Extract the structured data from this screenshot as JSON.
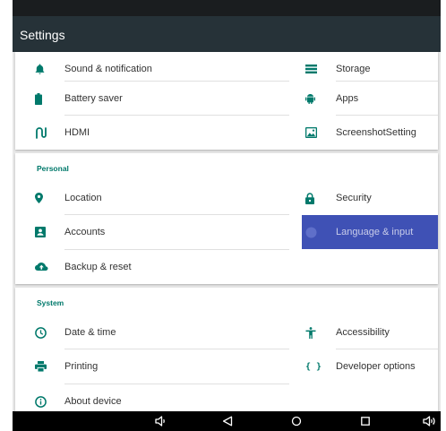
{
  "header": {
    "title": "Settings"
  },
  "device": {
    "items": [
      {
        "label": "Sound & notification",
        "icon": "bell-icon"
      },
      {
        "label": "Storage",
        "icon": "storage-icon"
      },
      {
        "label": "Battery saver",
        "icon": "battery-icon"
      },
      {
        "label": "Apps",
        "icon": "android-icon"
      },
      {
        "label": "HDMI",
        "icon": "hdmi-icon"
      },
      {
        "label": "ScreenshotSetting",
        "icon": "image-icon"
      }
    ]
  },
  "personal": {
    "title": "Personal",
    "items": [
      {
        "label": "Location",
        "icon": "location-pin-icon"
      },
      {
        "label": "Security",
        "icon": "lock-icon"
      },
      {
        "label": "Accounts",
        "icon": "account-icon"
      },
      {
        "label": "Language & input",
        "icon": "globe-icon",
        "selected": true
      },
      {
        "label": "Backup & reset",
        "icon": "cloud-upload-icon"
      }
    ]
  },
  "system": {
    "title": "System",
    "items": [
      {
        "label": "Date & time",
        "icon": "clock-icon"
      },
      {
        "label": "Accessibility",
        "icon": "accessibility-icon"
      },
      {
        "label": "Printing",
        "icon": "printer-icon"
      },
      {
        "label": "Developer options",
        "icon": "braces-icon"
      },
      {
        "label": "About device",
        "icon": "info-icon"
      }
    ]
  },
  "navbar": {
    "buttons": [
      "volume-down-icon",
      "back-icon",
      "home-icon",
      "recents-icon",
      "volume-up-icon"
    ]
  },
  "colors": {
    "appbar": "#263238",
    "accent": "#00796b",
    "selected": "#3f51b5",
    "navbar": "#000000"
  }
}
